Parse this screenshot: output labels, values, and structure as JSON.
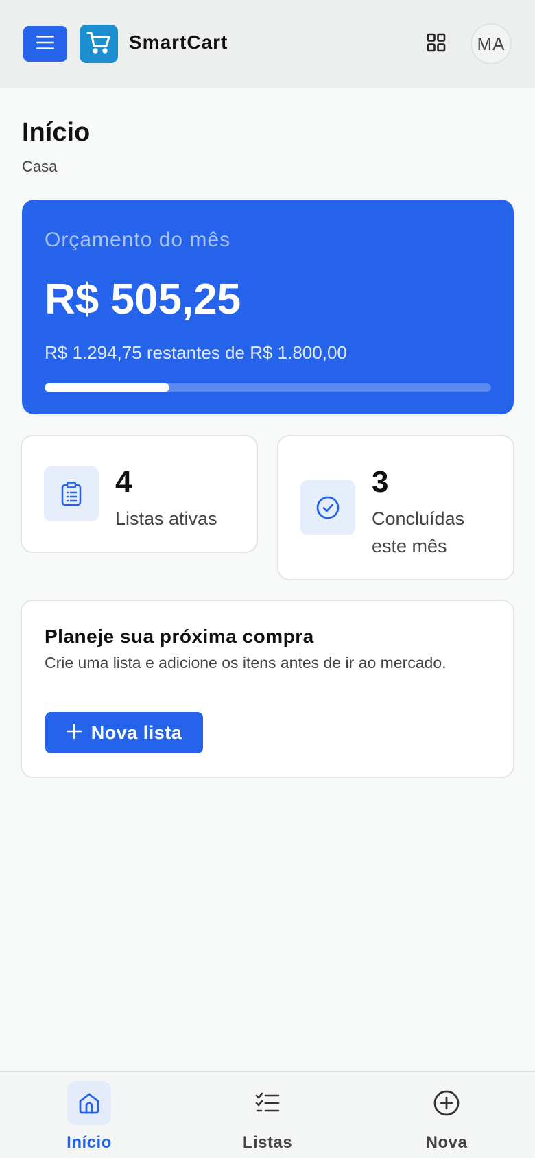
{
  "app": {
    "name": "SmartCart",
    "avatar_initials": "MA"
  },
  "page": {
    "title": "Início",
    "subtitle": "Casa"
  },
  "budget": {
    "label": "Orçamento do mês",
    "amount": "R$ 505,25",
    "remaining_text": "R$ 1.294,75 restantes de R$ 1.800,00",
    "spent_fraction": 0.28
  },
  "stats": [
    {
      "value": "4",
      "label": "Listas ativas",
      "icon": "clipboard-icon"
    },
    {
      "value": "3",
      "label": "Concluídas este mês",
      "icon": "check-circle-icon"
    }
  ],
  "plan": {
    "title": "Planeje sua próxima compra",
    "description": "Crie uma lista e adicione os itens antes de ir ao mercado.",
    "button_label": "Nova lista"
  },
  "nav": {
    "items": [
      {
        "label": "Início",
        "icon": "home-icon",
        "active": true
      },
      {
        "label": "Listas",
        "icon": "checklist-icon",
        "active": false
      },
      {
        "label": "Nova",
        "icon": "plus-circle-icon",
        "active": false
      }
    ]
  },
  "colors": {
    "primary": "#2563eb",
    "logo": "#1d8fd0",
    "icon_bg": "#e6eefc",
    "background": "#f7f8f8"
  }
}
